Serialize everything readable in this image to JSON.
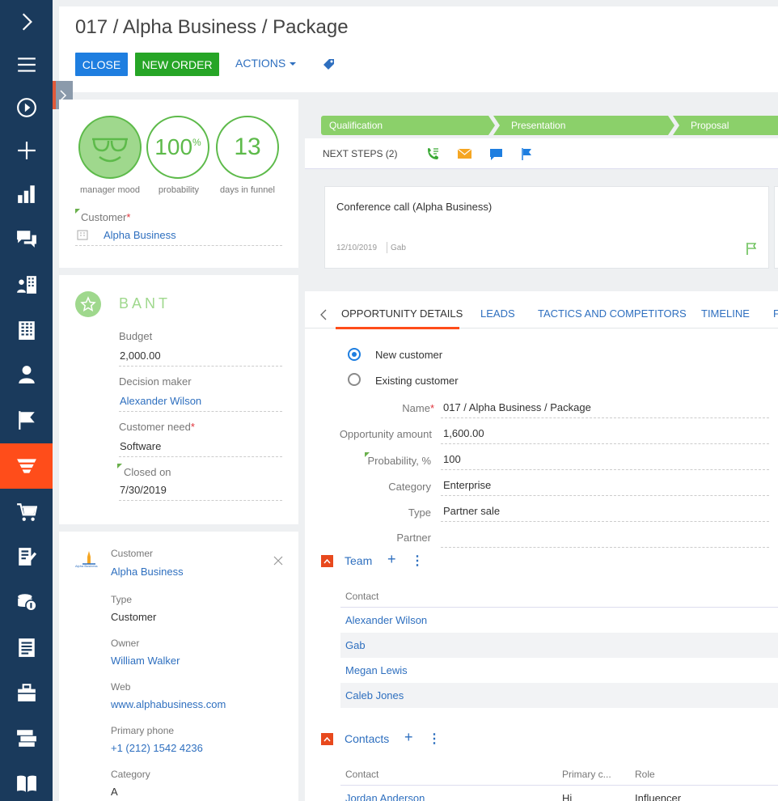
{
  "header": {
    "title": "017 / Alpha Business / Package",
    "close_label": "CLOSE",
    "new_order_label": "NEW ORDER",
    "actions_label": "ACTIONS"
  },
  "nav": {
    "items": [
      "expand-icon",
      "menu-icon",
      "play-icon",
      "plus-icon",
      "dashboard-icon",
      "feed-icon",
      "accounts-icon",
      "companies-icon",
      "contacts-icon",
      "activities-icon",
      "opportunities-icon",
      "orders-icon",
      "contracts-icon",
      "invoices-icon",
      "documents-icon",
      "projects-icon",
      "products-icon",
      "knowledge-base-icon"
    ],
    "active": "opportunities-icon"
  },
  "summary": {
    "probability": "100",
    "probability_unit": "%",
    "days": "13",
    "mood_caption": "manager mood",
    "probability_caption": "probability",
    "days_caption": "days in funnel",
    "customer_label": "Customer",
    "customer_value": "Alpha Business"
  },
  "bant": {
    "title": "BANT",
    "budget_label": "Budget",
    "budget_value": "2,000.00",
    "decision_maker_label": "Decision maker",
    "decision_maker_value": "Alexander Wilson",
    "customer_need_label": "Customer need",
    "customer_need_value": "Software",
    "closed_on_label": "Closed on",
    "closed_on_value": "7/30/2019"
  },
  "account": {
    "logo_text": "Alpha Business",
    "customer_label": "Customer",
    "customer_value": "Alpha Business",
    "type_label": "Type",
    "type_value": "Customer",
    "owner_label": "Owner",
    "owner_value": "William Walker",
    "web_label": "Web",
    "web_value": "www.alphabusiness.com",
    "phone_label": "Primary phone",
    "phone_value": "+1 (212) 1542 4236",
    "category_label": "Category",
    "category_value": "A"
  },
  "stages": [
    "Qualification",
    "Presentation",
    "Proposal"
  ],
  "next_steps": {
    "label": "NEXT STEPS (2)",
    "card_title": "Conference call (Alpha Business)",
    "card_date": "12/10/2019",
    "card_owner": "Gab"
  },
  "tabs": [
    "OPPORTUNITY DETAILS",
    "LEADS",
    "TACTICS AND COMPETITORS",
    "TIMELINE",
    "F"
  ],
  "details": {
    "radio_new": "New customer",
    "radio_existing": "Existing customer",
    "name_label": "Name",
    "name_value": "017 / Alpha Business / Package",
    "amount_label": "Opportunity amount",
    "amount_value": "1,600.00",
    "probability_label": "Probability, %",
    "probability_value": "100",
    "category_label": "Category",
    "category_value": "Enterprise",
    "type_label": "Type",
    "type_value": "Partner sale",
    "partner_label": "Partner",
    "partner_value": ""
  },
  "team": {
    "title": "Team",
    "column": "Contact",
    "rows": [
      "Alexander Wilson",
      "Gab",
      "Megan Lewis",
      "Caleb Jones"
    ]
  },
  "contacts": {
    "title": "Contacts",
    "columns": [
      "Contact",
      "Primary c...",
      "Role"
    ],
    "row": [
      "Jordan Anderson",
      "Hi",
      "Influencer"
    ]
  }
}
